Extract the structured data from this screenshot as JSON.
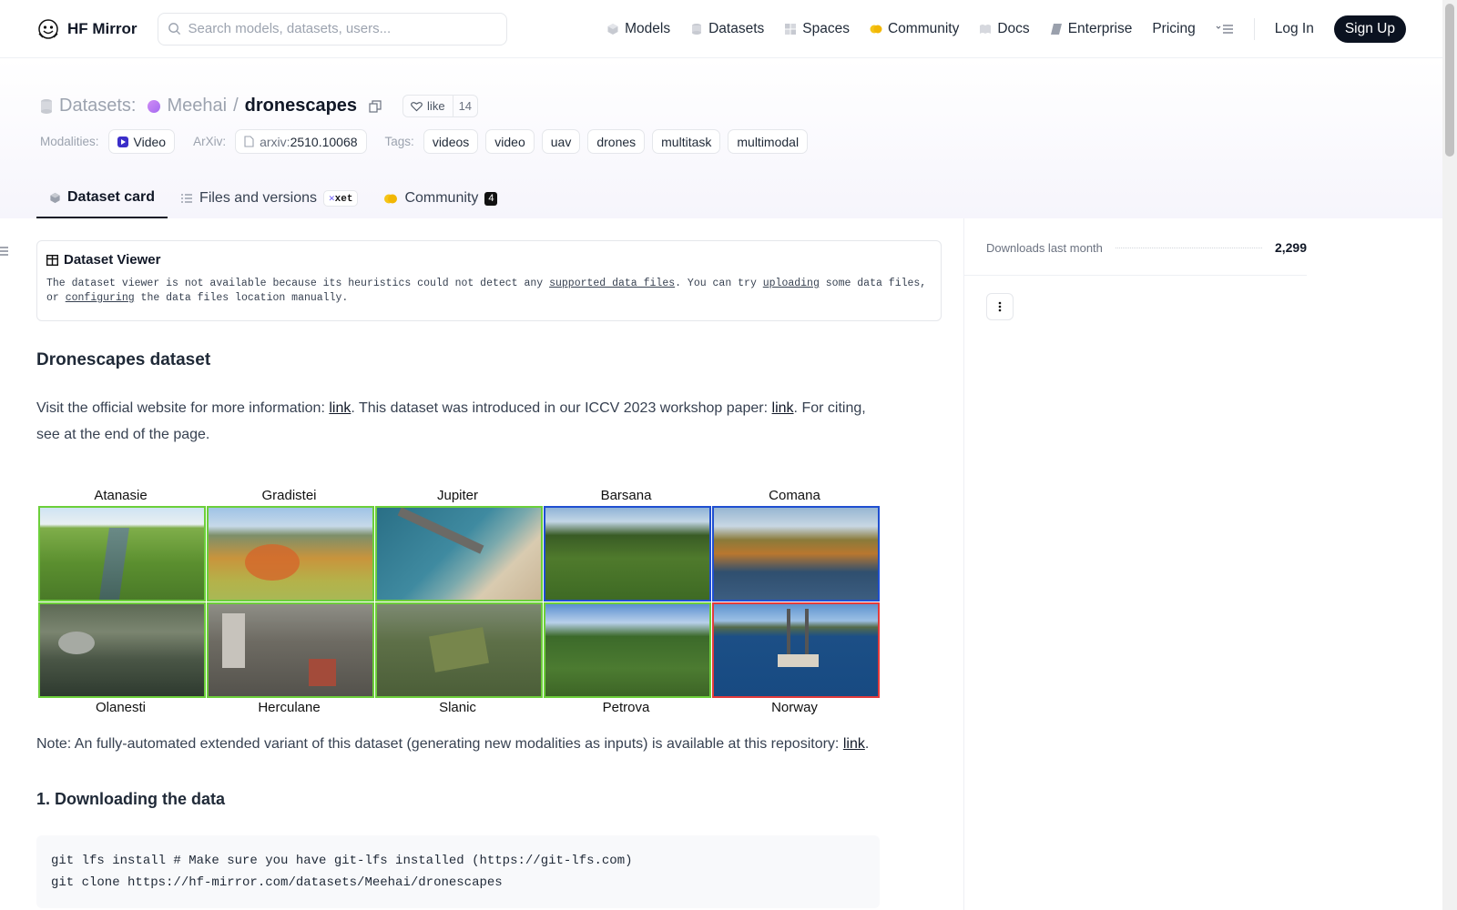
{
  "nav": {
    "brand": "HF Mirror",
    "search_placeholder": "Search models, datasets, users...",
    "links": [
      "Models",
      "Datasets",
      "Spaces",
      "Community",
      "Docs",
      "Enterprise",
      "Pricing"
    ],
    "login": "Log In",
    "signup": "Sign Up"
  },
  "repo": {
    "kind_label": "Datasets:",
    "owner": "Meehai",
    "separator": "/",
    "name": "dronescapes",
    "like_label": "like",
    "like_count": "14",
    "modalities_label": "Modalities:",
    "modality": "Video",
    "arxiv_label": "ArXiv:",
    "arxiv_prefix": "arxiv:",
    "arxiv_id": "2510.10068",
    "tags_label": "Tags:",
    "tags": [
      "videos",
      "video",
      "uav",
      "drones",
      "multitask",
      "multimodal"
    ]
  },
  "tabs": {
    "card": "Dataset card",
    "files": "Files and versions",
    "xet": "xet",
    "community": "Community",
    "community_count": "4"
  },
  "viewer": {
    "title": "Dataset Viewer",
    "msg1": "The dataset viewer is not available because its heuristics could not detect any ",
    "link1": "supported data files",
    "msg2": ". You can try ",
    "link2": "uploading",
    "msg3": " some data files, or ",
    "link3": "configuring",
    "msg4": " the data files location manually."
  },
  "content": {
    "heading": "Dronescapes dataset",
    "intro1": "Visit the official website for more information: ",
    "intro_link1": "link",
    "intro2": ". This dataset was introduced in our ICCV 2023 workshop paper: ",
    "intro_link2": "link",
    "intro3": ". For citing, see at the end of the page.",
    "top_labels": [
      "Atanasie",
      "Gradistei",
      "Jupiter",
      "Barsana",
      "Comana"
    ],
    "bottom_labels": [
      "Olanesti",
      "Herculane",
      "Slanic",
      "Petrova",
      "Norway"
    ],
    "note1": "Note: An fully-automated extended variant of this dataset (generating new modalities as inputs) is available at this repository: ",
    "note_link": "link",
    "note2": ".",
    "section1": "1. Downloading the data",
    "code_line1": "git lfs install # Make sure you have git-lfs installed (https://git-lfs.com)",
    "code_line2": "git clone https://hf-mirror.com/datasets/Meehai/dronescapes"
  },
  "sidebar": {
    "downloads_label": "Downloads last month",
    "downloads_value": "2,299"
  },
  "colors": {
    "tile_green": "#6ccf3a",
    "tile_blue": "#1f4fd1",
    "tile_red": "#e33b3b"
  }
}
